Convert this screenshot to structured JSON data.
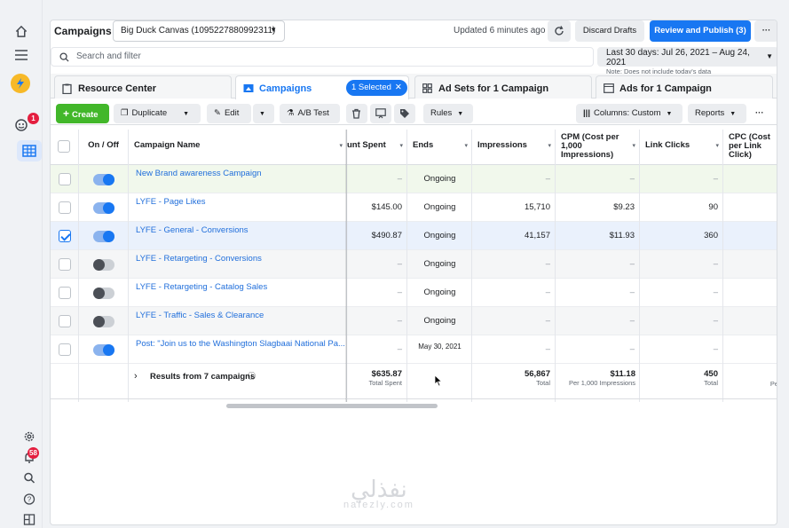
{
  "rail": {
    "notifications_badge": "1",
    "alerts_badge": "58"
  },
  "topbar": {
    "title": "Campaigns",
    "account": "Big Duck Canvas (1095227880992311)",
    "updated": "Updated 6 minutes ago",
    "discard": "Discard Drafts",
    "publish": "Review and Publish (3)",
    "more": "···"
  },
  "search": {
    "placeholder": "Search and filter"
  },
  "daterange": {
    "label": "Last 30 days: Jul 26, 2021 – Aug 24, 2021",
    "note": "Note: Does not include today's data"
  },
  "tabs": {
    "resource": "Resource Center",
    "campaigns": "Campaigns",
    "selected_chip": "1 Selected",
    "adsets": "Ad Sets for 1 Campaign",
    "ads": "Ads for 1 Campaign"
  },
  "toolbar": {
    "create": "Create",
    "duplicate": "Duplicate",
    "edit": "Edit",
    "abtest": "A/B Test",
    "rules": "Rules",
    "columns": "Columns: Custom",
    "reports": "Reports",
    "more": "···"
  },
  "table": {
    "headers": {
      "onoff": "On / Off",
      "name": "Campaign Name",
      "spent": "unt Spent",
      "ends": "Ends",
      "impressions": "Impressions",
      "cpm": "CPM (Cost per 1,000 Impressions)",
      "clicks": "Link Clicks",
      "cpc": "CPC (Cost per Link Click)"
    },
    "rows": [
      {
        "name": "New Brand awareness Campaign",
        "spent": "–",
        "ends": "Ongoing",
        "impressions": "–",
        "cpm": "–",
        "clicks": "–",
        "on": true,
        "checked": false,
        "tint": "#f1f8ec"
      },
      {
        "name": "LYFE - Page Likes",
        "spent": "$145.00",
        "ends": "Ongoing",
        "impressions": "15,710",
        "cpm": "$9.23",
        "clicks": "90",
        "on": true,
        "checked": false,
        "tint": "#ffffff"
      },
      {
        "name": "LYFE - General - Conversions",
        "spent": "$490.87",
        "ends": "Ongoing",
        "impressions": "41,157",
        "cpm": "$11.93",
        "clicks": "360",
        "on": true,
        "checked": true,
        "tint": "#eaf1fc"
      },
      {
        "name": "LYFE - Retargeting - Conversions",
        "spent": "–",
        "ends": "Ongoing",
        "impressions": "–",
        "cpm": "–",
        "clicks": "–",
        "on": false,
        "checked": false,
        "tint": "#f5f6f7"
      },
      {
        "name": "LYFE - Retargeting - Catalog Sales",
        "spent": "–",
        "ends": "Ongoing",
        "impressions": "–",
        "cpm": "–",
        "clicks": "–",
        "on": false,
        "checked": false,
        "tint": "#ffffff"
      },
      {
        "name": "LYFE - Traffic - Sales & Clearance",
        "spent": "–",
        "ends": "Ongoing",
        "impressions": "–",
        "cpm": "–",
        "clicks": "–",
        "on": false,
        "checked": false,
        "tint": "#f5f6f7"
      },
      {
        "name": "Post: \"Join us to the Washington Slagbaai National Pa...",
        "spent": "–",
        "ends": "May 30, 2021",
        "impressions": "–",
        "cpm": "–",
        "clicks": "–",
        "on": true,
        "checked": false,
        "tint": "#ffffff"
      }
    ],
    "totals": {
      "label": "Results from 7 campaigns",
      "spent": "$635.87",
      "spent_sub": "Total Spent",
      "impressions": "56,867",
      "impressions_sub": "Total",
      "cpm": "$11.18",
      "cpm_sub": "Per 1,000 Impressions",
      "clicks": "450",
      "clicks_sub": "Total",
      "cpc_sub": "Pe"
    }
  },
  "watermark": {
    "arabic": "نفذلي",
    "latin": "nafezly.com"
  }
}
